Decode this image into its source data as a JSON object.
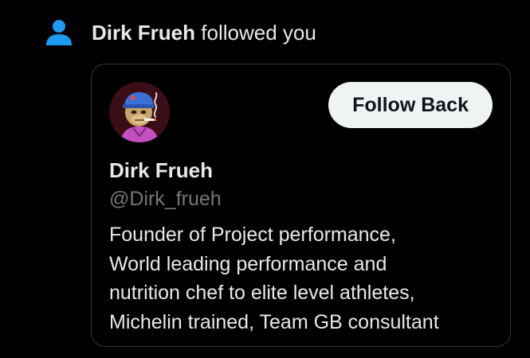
{
  "notification": {
    "actor_name": "Dirk Frueh",
    "action_text": " followed you",
    "icon": "person-icon",
    "icon_color": "#1d9bf0"
  },
  "user_card": {
    "avatar": "avatar-ape-icon",
    "follow_button_label": "Follow Back",
    "display_name": "Dirk Frueh",
    "handle": "@Dirk_frueh",
    "bio_lines": [
      "Founder of Project performance,",
      "World leading performance and",
      "nutrition chef to elite level athletes,",
      "Michelin trained, Team GB consultant"
    ]
  },
  "colors": {
    "background": "#000000",
    "text_primary": "#e7e9ea",
    "text_secondary": "#71767b",
    "card_border": "#2f3336",
    "button_bg": "#eff3f4"
  }
}
